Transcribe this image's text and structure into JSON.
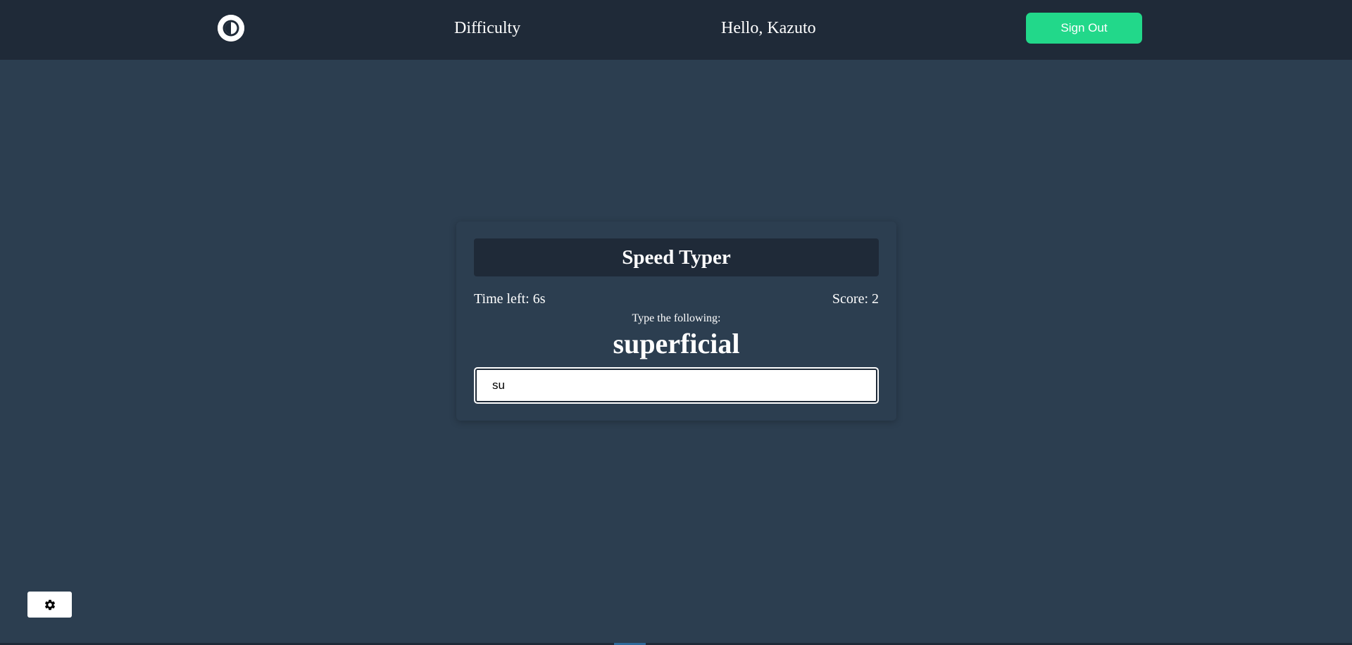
{
  "navbar": {
    "theme_toggle_icon": "contrast-icon",
    "difficulty_label": "Difficulty",
    "greeting": "Hello, Kazuto",
    "signout_label": "Sign Out"
  },
  "game": {
    "title": "Speed Typer",
    "time_left": "Time left: 6s",
    "score": "Score: 2",
    "instruction": "Type the following:",
    "target_word": "superficial",
    "input_value": "su"
  },
  "settings": {
    "icon": "gear-icon"
  },
  "colors": {
    "background": "#2c3e50",
    "navbar": "#1f2a38",
    "accent": "#22d88a",
    "text": "#ffffff"
  }
}
